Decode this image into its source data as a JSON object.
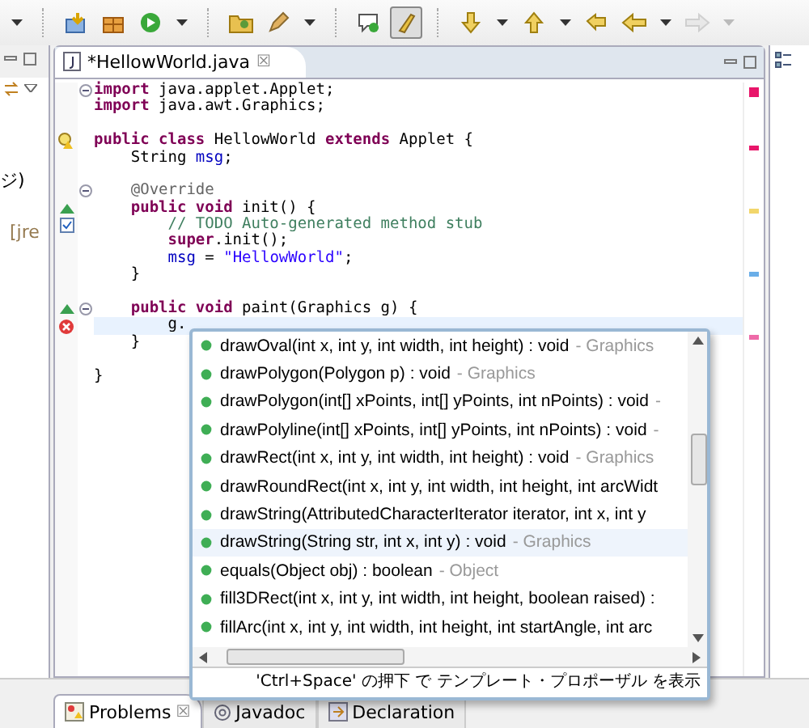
{
  "toolbar": [
    {
      "kind": "caret",
      "disabled": false
    },
    {
      "kind": "separator"
    },
    {
      "kind": "project",
      "on": false,
      "disabled": false
    },
    {
      "kind": "gift",
      "on": false,
      "disabled": false
    },
    {
      "kind": "run",
      "on": false,
      "disabled": false
    },
    {
      "kind": "caret",
      "disabled": false
    },
    {
      "kind": "separator"
    },
    {
      "kind": "folder",
      "on": false,
      "disabled": false
    },
    {
      "kind": "pen",
      "on": false,
      "disabled": false
    },
    {
      "kind": "caret",
      "disabled": false
    },
    {
      "kind": "separator"
    },
    {
      "kind": "bubble",
      "on": false,
      "disabled": false
    },
    {
      "kind": "brush",
      "on": true,
      "disabled": false
    },
    {
      "kind": "separator"
    },
    {
      "kind": "down",
      "on": false,
      "disabled": false
    },
    {
      "kind": "caret",
      "disabled": false
    },
    {
      "kind": "up",
      "on": false,
      "disabled": false
    },
    {
      "kind": "caret",
      "disabled": false
    },
    {
      "kind": "back",
      "on": false,
      "disabled": false
    },
    {
      "kind": "left",
      "on": false,
      "disabled": false
    },
    {
      "kind": "caret",
      "disabled": false
    },
    {
      "kind": "right",
      "on": false,
      "disabled": true
    },
    {
      "kind": "caret",
      "disabled": true
    }
  ],
  "left_panel": {
    "items": [
      "ジ)",
      "[jre"
    ]
  },
  "editor": {
    "tab": {
      "title": "*HellowWorld.java",
      "close": "☒"
    },
    "lines": [
      {
        "kind": "fold",
        "current": false,
        "segments": [
          {
            "kind": "keyword",
            "text": "import"
          },
          {
            "kind": "plain",
            "text": " java.applet.Applet;"
          }
        ]
      },
      {
        "kind": "plain",
        "current": false,
        "segments": [
          {
            "kind": "keyword",
            "text": "import"
          },
          {
            "kind": "plain",
            "text": " java.awt.Graphics;"
          }
        ]
      },
      {
        "kind": "plain",
        "current": false
      },
      {
        "kind": "warning",
        "current": false,
        "segments": [
          {
            "kind": "keyword",
            "text": "public class"
          },
          {
            "kind": "plain",
            "text": " HellowWorld "
          },
          {
            "kind": "keyword",
            "text": "extends"
          },
          {
            "kind": "plain",
            "text": " Applet {"
          }
        ]
      },
      {
        "kind": "plain",
        "current": false,
        "segments": [
          {
            "kind": "plain",
            "text": "    String "
          },
          {
            "kind": "field",
            "text": "msg"
          },
          {
            "kind": "plain",
            "text": ";"
          }
        ]
      },
      {
        "kind": "plain",
        "current": false
      },
      {
        "kind": "fold",
        "current": false,
        "segments": [
          {
            "kind": "annotation",
            "text": "    @Override"
          }
        ]
      },
      {
        "kind": "override",
        "current": false,
        "segments": [
          {
            "kind": "keyword",
            "text": "    public void"
          },
          {
            "kind": "plain",
            "text": " init() {"
          }
        ]
      },
      {
        "kind": "task",
        "current": false,
        "segments": [
          {
            "kind": "comment",
            "text": "        // TODO Auto-generated method stub"
          }
        ]
      },
      {
        "kind": "plain",
        "current": false,
        "segments": [
          {
            "kind": "keyword",
            "text": "        super"
          },
          {
            "kind": "plain",
            "text": ".init();"
          }
        ]
      },
      {
        "kind": "plain",
        "current": false,
        "segments": [
          {
            "kind": "field",
            "text": "        msg"
          },
          {
            "kind": "plain",
            "text": " = "
          },
          {
            "kind": "string",
            "text": "\"HellowWorld\""
          },
          {
            "kind": "plain",
            "text": ";"
          }
        ]
      },
      {
        "kind": "plain",
        "current": false,
        "segments": [
          {
            "kind": "plain",
            "text": "    }"
          }
        ]
      },
      {
        "kind": "plain",
        "current": false
      },
      {
        "kind": "override-fold",
        "current": false,
        "segments": [
          {
            "kind": "keyword",
            "text": "    public void"
          },
          {
            "kind": "plain",
            "text": " paint(Graphics g) {"
          }
        ]
      },
      {
        "kind": "error",
        "current": true,
        "segments": [
          {
            "kind": "plain",
            "text": "        g."
          }
        ]
      },
      {
        "kind": "plain",
        "current": false,
        "segments": [
          {
            "kind": "plain",
            "text": "    }"
          }
        ]
      },
      {
        "kind": "plain",
        "current": false
      },
      {
        "kind": "plain",
        "current": false,
        "segments": [
          {
            "kind": "plain",
            "text": "}"
          }
        ]
      }
    ],
    "ruler_marks": [
      {
        "color": "#e8166a"
      },
      {
        "color": "#f2d66b"
      },
      {
        "color": "#6aaee8"
      },
      {
        "color": "#ee6aa8"
      }
    ]
  },
  "completion": {
    "items": [
      {
        "text": "drawOval(int x, int y, int width, int height) : void",
        "owner": "- Graphics",
        "selected": false
      },
      {
        "text": "drawPolygon(Polygon p) : void",
        "owner": "- Graphics",
        "selected": false
      },
      {
        "text": "drawPolygon(int[] xPoints, int[] yPoints, int nPoints) : void",
        "owner": "-",
        "selected": false
      },
      {
        "text": "drawPolyline(int[] xPoints, int[] yPoints, int nPoints) : void",
        "owner": "-",
        "selected": false
      },
      {
        "text": "drawRect(int x, int y, int width, int height) : void",
        "owner": "- Graphics",
        "selected": false
      },
      {
        "text": "drawRoundRect(int x, int y, int width, int height, int arcWidt",
        "selected": false
      },
      {
        "text": "drawString(AttributedCharacterIterator iterator, int x, int y",
        "selected": false
      },
      {
        "text": "drawString(String str, int x, int y) : void",
        "owner": "- Graphics",
        "selected": true
      },
      {
        "text": "equals(Object obj) : boolean",
        "owner": "- Object",
        "selected": false
      },
      {
        "text": "fill3DRect(int x, int y, int width, int height, boolean raised) :",
        "selected": false
      },
      {
        "text": "fillArc(int x, int y, int width, int height, int startAngle, int arc",
        "selected": false
      }
    ],
    "footer": "'Ctrl+Space' の押下 で テンプレート・プロポーザル を表示"
  },
  "bottom_tabs": [
    {
      "label": "Problems",
      "selected": true,
      "close": "☒"
    },
    {
      "label": "Javadoc",
      "selected": false
    },
    {
      "label": "Declaration",
      "selected": false
    }
  ]
}
